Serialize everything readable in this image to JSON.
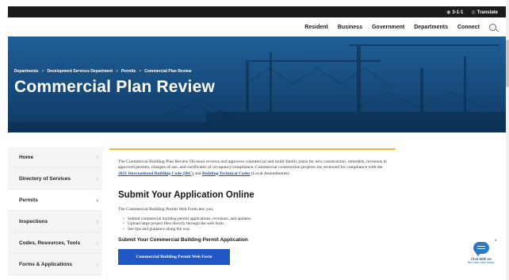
{
  "utility": {
    "phone_label": "3-1-1",
    "translate_label": "Translate"
  },
  "nav": {
    "items": [
      "Resident",
      "Business",
      "Government",
      "Departments",
      "Connect"
    ]
  },
  "hero": {
    "breadcrumb": [
      "Departments",
      "Development Services Department",
      "Permits",
      "Commercial Plan Review"
    ],
    "breadcrumb_separator": ">",
    "title": "Commercial Plan Review"
  },
  "sidebar": {
    "items": [
      {
        "label": "Home",
        "active": false
      },
      {
        "label": "Directory of Services",
        "active": false
      },
      {
        "label": "Permits",
        "active": true
      },
      {
        "label": "Inspections",
        "active": false
      },
      {
        "label": "Codes, Resources, Tools",
        "active": false
      },
      {
        "label": "Forms & Applications",
        "active": false
      }
    ]
  },
  "content": {
    "intro_part1": "The Commercial Building Plan Review Division reviews and approves commercial and multi-family plans for new construction, remodels, revisions to approved permits, changes of use, and certificates of occupancy/compliance. Commercial construction projects are reviewed for compliance with the ",
    "intro_link1": "2021 International Building Code (IBC)",
    "intro_mid": " and ",
    "intro_link2": "Building Technical Codes",
    "intro_end": " (Local Amendments).",
    "heading": "Submit Your Application Online",
    "lead": "The Commercial Building Permit Web Form lets you:",
    "bullets": [
      "Submit commercial building permit applications, revisions, and updates.",
      "Upload large project files directly through the web form.",
      "See tips and guidance along the way."
    ],
    "subheading": "Submit Your Commercial Building Permit Application",
    "cta_label": "Commercial Building Permit Web Form"
  },
  "chat": {
    "close": "×",
    "title": "Chat With Us",
    "subtitle": "We have new hours."
  },
  "colors": {
    "utility_bg": "#1b1b1b",
    "hero_blue": "#184e80",
    "accent": "#f2b73c",
    "cta_blue": "#1f57c7",
    "link": "#1e55a8"
  }
}
